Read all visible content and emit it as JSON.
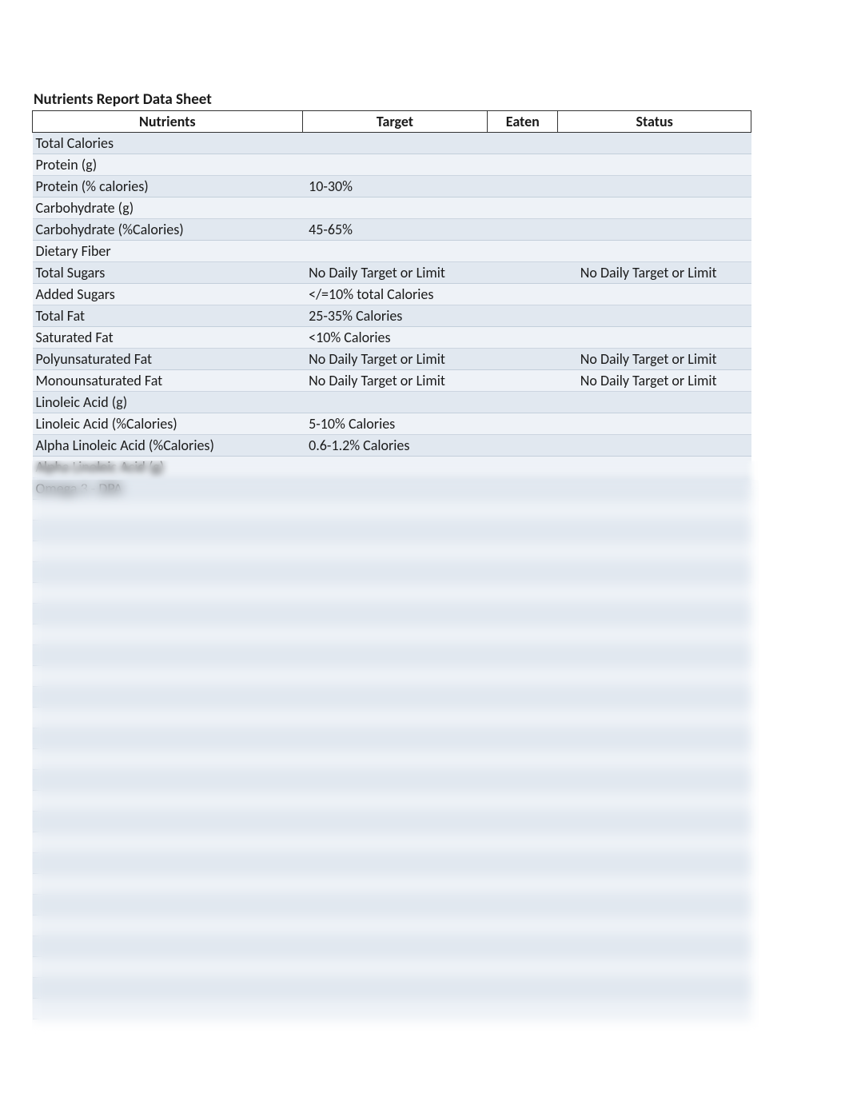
{
  "title": "Nutrients Report Data Sheet",
  "headers": {
    "c1": "Nutrients",
    "c2": "Target",
    "c3": "Eaten",
    "c4": "Status"
  },
  "rows": [
    {
      "nutrient": "Total Calories",
      "target": "",
      "eaten": "",
      "status": ""
    },
    {
      "nutrient": "Protein (g)",
      "target": "",
      "eaten": "",
      "status": ""
    },
    {
      "nutrient": "Protein (% calories)",
      "target": "10-30%",
      "eaten": "",
      "status": ""
    },
    {
      "nutrient": "Carbohydrate (g)",
      "target": "",
      "eaten": "",
      "status": ""
    },
    {
      "nutrient": "Carbohydrate (%Calories)",
      "target": "45-65%",
      "eaten": "",
      "status": ""
    },
    {
      "nutrient": "Dietary Fiber",
      "target": "",
      "eaten": "",
      "status": ""
    },
    {
      "nutrient": "Total Sugars",
      "target": "No Daily Target or Limit",
      "eaten": "",
      "status": "No Daily Target or Limit"
    },
    {
      "nutrient": "Added Sugars",
      "target": "</=10% total Calories",
      "eaten": "",
      "status": ""
    },
    {
      "nutrient": "Total Fat",
      "target": "25-35% Calories",
      "eaten": "",
      "status": ""
    },
    {
      "nutrient": "Saturated Fat",
      "target": "<10%  Calories",
      "eaten": "",
      "status": ""
    },
    {
      "nutrient": "Polyunsaturated Fat",
      "target": "No Daily Target or Limit",
      "eaten": "",
      "status": "No Daily Target or Limit"
    },
    {
      "nutrient": "Monounsaturated Fat",
      "target": "No Daily Target or Limit",
      "eaten": "",
      "status": "No Daily Target or Limit"
    },
    {
      "nutrient": "Linoleic Acid (g)",
      "target": "",
      "eaten": "",
      "status": ""
    },
    {
      "nutrient": "Linoleic Acid (%Calories)",
      "target": "5-10% Calories",
      "eaten": "",
      "status": ""
    },
    {
      "nutrient": "Alpha Linoleic Acid (%Calories)",
      "target": "0.6-1.2% Calories",
      "eaten": "",
      "status": ""
    },
    {
      "nutrient": "Alpha Linoleic Acid (g)",
      "target": "",
      "eaten": "",
      "status": ""
    },
    {
      "nutrient": "Omega 3 - DPA",
      "target": "",
      "eaten": "",
      "status": ""
    },
    {
      "nutrient": "",
      "target": "",
      "eaten": "",
      "status": ""
    },
    {
      "nutrient": "",
      "target": "",
      "eaten": "",
      "status": ""
    },
    {
      "nutrient": "",
      "target": "",
      "eaten": "",
      "status": ""
    },
    {
      "nutrient": "",
      "target": "",
      "eaten": "",
      "status": ""
    },
    {
      "nutrient": "",
      "target": "",
      "eaten": "",
      "status": ""
    },
    {
      "nutrient": "",
      "target": "",
      "eaten": "",
      "status": ""
    },
    {
      "nutrient": "",
      "target": "",
      "eaten": "",
      "status": ""
    },
    {
      "nutrient": "",
      "target": "",
      "eaten": "",
      "status": ""
    },
    {
      "nutrient": "",
      "target": "",
      "eaten": "",
      "status": ""
    },
    {
      "nutrient": "",
      "target": "",
      "eaten": "",
      "status": ""
    },
    {
      "nutrient": "",
      "target": "",
      "eaten": "",
      "status": ""
    },
    {
      "nutrient": "",
      "target": "",
      "eaten": "",
      "status": ""
    },
    {
      "nutrient": "",
      "target": "",
      "eaten": "",
      "status": ""
    },
    {
      "nutrient": "",
      "target": "",
      "eaten": "",
      "status": ""
    },
    {
      "nutrient": "",
      "target": "",
      "eaten": "",
      "status": ""
    },
    {
      "nutrient": "",
      "target": "",
      "eaten": "",
      "status": ""
    },
    {
      "nutrient": "",
      "target": "",
      "eaten": "",
      "status": ""
    },
    {
      "nutrient": "",
      "target": "",
      "eaten": "",
      "status": ""
    },
    {
      "nutrient": "",
      "target": "",
      "eaten": "",
      "status": ""
    },
    {
      "nutrient": "",
      "target": "",
      "eaten": "",
      "status": ""
    },
    {
      "nutrient": "",
      "target": "",
      "eaten": "",
      "status": ""
    },
    {
      "nutrient": "",
      "target": "",
      "eaten": "",
      "status": ""
    },
    {
      "nutrient": "",
      "target": "",
      "eaten": "",
      "status": ""
    },
    {
      "nutrient": "",
      "target": "",
      "eaten": "",
      "status": ""
    },
    {
      "nutrient": "",
      "target": "",
      "eaten": "",
      "status": ""
    }
  ]
}
